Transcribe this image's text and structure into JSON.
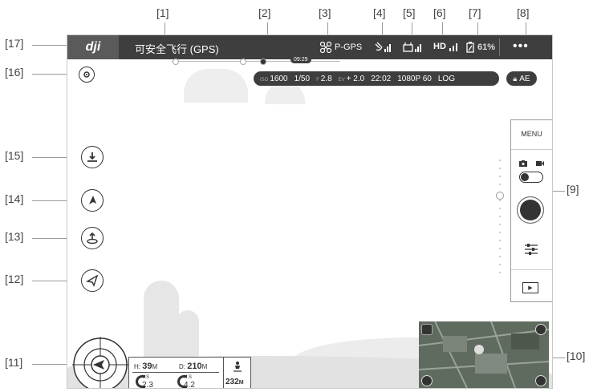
{
  "callouts": [
    "[1]",
    "[2]",
    "[3]",
    "[4]",
    "[5]",
    "[6]",
    "[7]",
    "[8]",
    "[9]",
    "[10]",
    "[11]",
    "[12]",
    "[13]",
    "[14]",
    "[15]",
    "[16]",
    "[17]"
  ],
  "topbar": {
    "logo": "dji",
    "status": "可安全飞行 (GPS)",
    "flight_mode": "P-GPS",
    "hd_label": "HD",
    "battery": "61%",
    "more": "•••"
  },
  "progress": {
    "time": "09:29"
  },
  "camera_params": {
    "iso_label": "ISO",
    "iso": "1600",
    "shutter": "1/50",
    "f_label": "F",
    "aperture": "2.8",
    "ev_label": "EV",
    "ev": "+ 2.0",
    "remaining": "22:02",
    "resolution": "1080P 60",
    "color": "LOG"
  },
  "ae": "AE",
  "right_panel": {
    "menu": "MENU"
  },
  "telemetry": {
    "h_label": "H:",
    "h_value": "39",
    "h_unit": "M",
    "d_label": "D:",
    "d_value": "210",
    "d_unit": "M",
    "vs_label": "V.S",
    "vs_value": "2.3",
    "hs_label": "H.S",
    "hs_value": "4.2",
    "dist_value": "232",
    "dist_unit": "M"
  },
  "colors": {
    "bar": "#3e3e3e",
    "accent": "#ffffff"
  }
}
